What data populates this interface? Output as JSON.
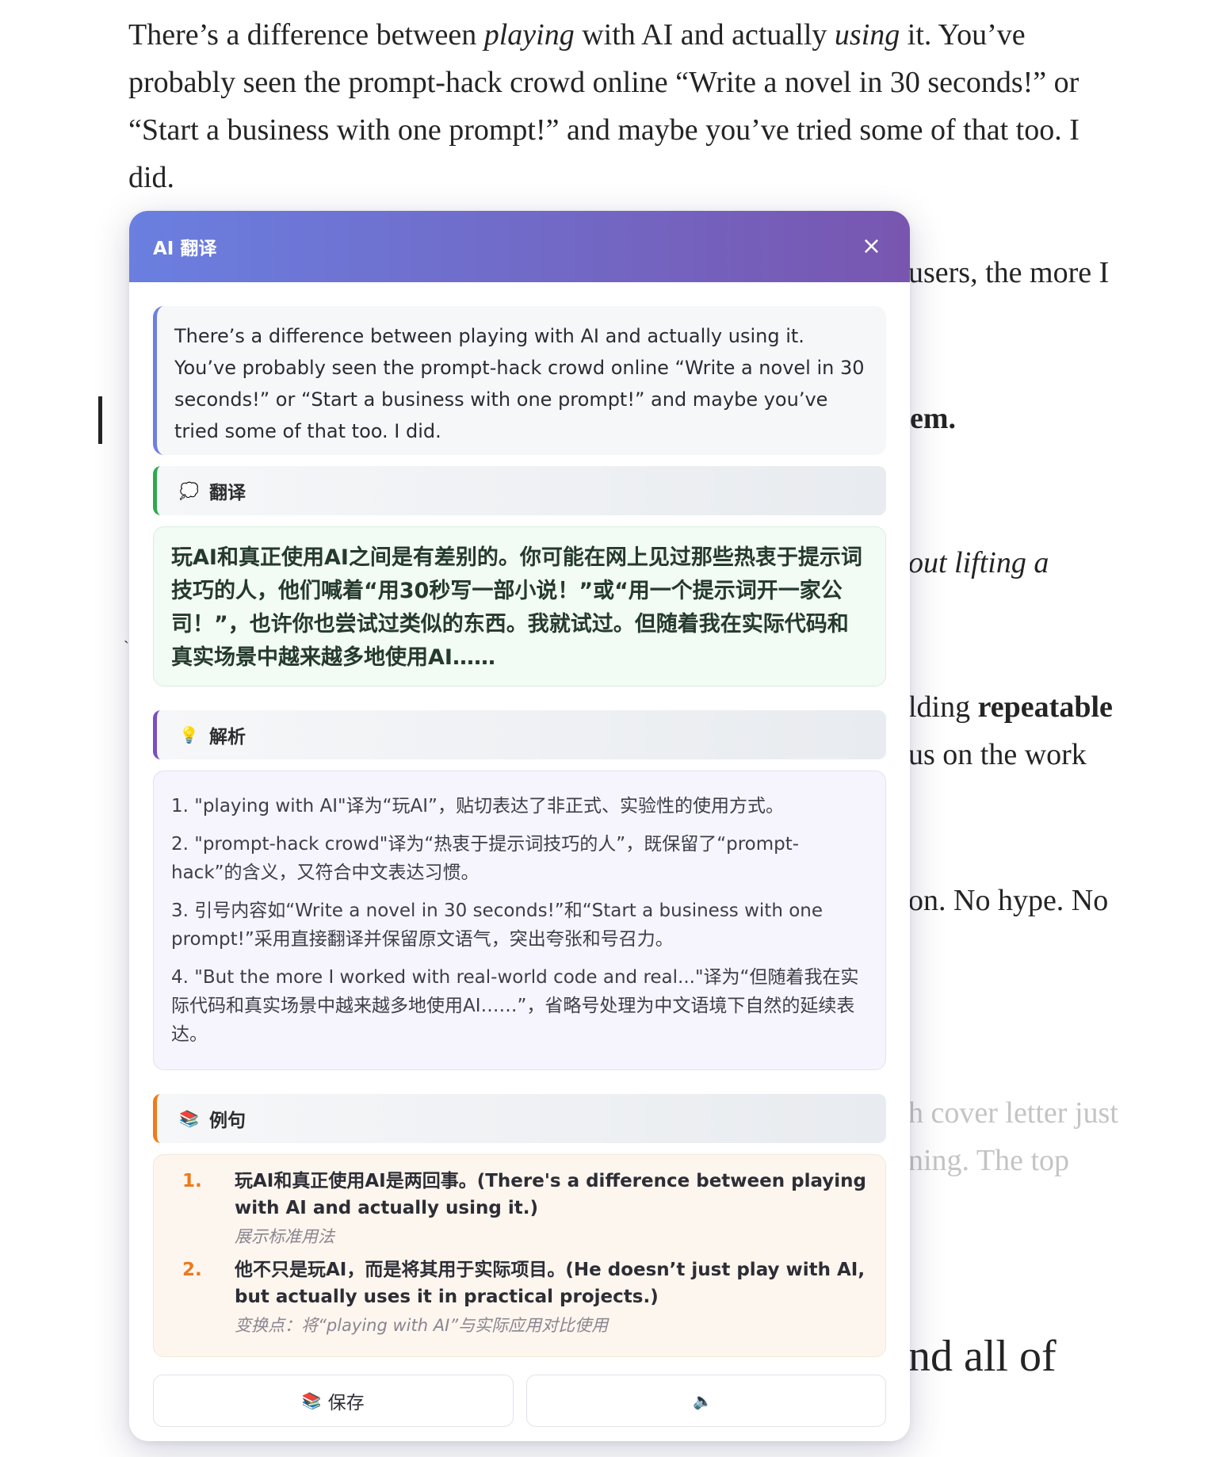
{
  "article": {
    "intro_parts": [
      "There’s a difference between ",
      "playing",
      " with AI and actually ",
      "using",
      " it. You’ve probably seen the prompt-hack crowd online “Write a novel in 30 seconds!” or “Start a business with one prompt!” and maybe you’ve tried some of that too. I did."
    ],
    "frag_users": "users, the more I",
    "frag_em": "em.",
    "frag_lifting": "out lifting a",
    "frag_repeat_prefix": "lding ",
    "frag_repeat_bold": "repeatable",
    "frag_focus": "us on the work",
    "frag_hype": "on. No hype. No",
    "frag_cover": "h cover letter just",
    "frag_ning": "ning. The top",
    "frag_all": "nd all of"
  },
  "panel": {
    "title": "AI 翻译",
    "close_icon": "×",
    "source_text": "There’s a difference between playing with AI and actually using it. You’ve probably seen the prompt-hack crowd online “Write a novel in 30 seconds!” or “Start a business with one prompt!” and maybe you’ve tried some of that too. I did.",
    "translation_header": {
      "icon": "💭",
      "label": "翻译"
    },
    "translation_text": "玩AI和真正使用AI之间是有差别的。你可能在网上见过那些热衷于提示词技巧的人，他们喊着“用30秒写一部小说！”或“用一个提示词开一家公司！”，也许你也尝试过类似的东西。我就试过。但随着我在实际代码和真实场景中越来越多地使用AI……",
    "analysis_header": {
      "icon": "💡",
      "label": "解析"
    },
    "analysis_items": [
      "1. \"playing with AI\"译为“玩AI”，贴切表达了非正式、实验性的使用方式。",
      "2. \"prompt-hack crowd\"译为“热衷于提示词技巧的人”，既保留了“prompt-hack”的含义，又符合中文表达习惯。",
      "3. 引号内容如“Write a novel in 30 seconds!”和“Start a business with one prompt!”采用直接翻译并保留原文语气，突出夸张和号召力。",
      "4. \"But the more I worked with real-world code and real...\"译为“但随着我在实际代码和真实场景中越来越多地使用AI……”，省略号处理为中文语境下自然的延续表达。"
    ],
    "examples_header": {
      "icon": "📚",
      "label": "例句"
    },
    "examples": [
      {
        "num": "1.",
        "sentence": "玩AI和真正使用AI是两回事。(There's a difference between playing with AI and actually using it.)",
        "note": "展示标准用法"
      },
      {
        "num": "2.",
        "sentence": "他不只是玩AI，而是将其用于实际项目。(He doesn’t just play with AI, but actually uses it in practical projects.)",
        "note": "变换点：将“playing with AI”与实际应用对比使用"
      }
    ],
    "save_button": {
      "icon": "📚",
      "label": "保存"
    },
    "speak_button": {
      "icon": "🔈"
    }
  }
}
